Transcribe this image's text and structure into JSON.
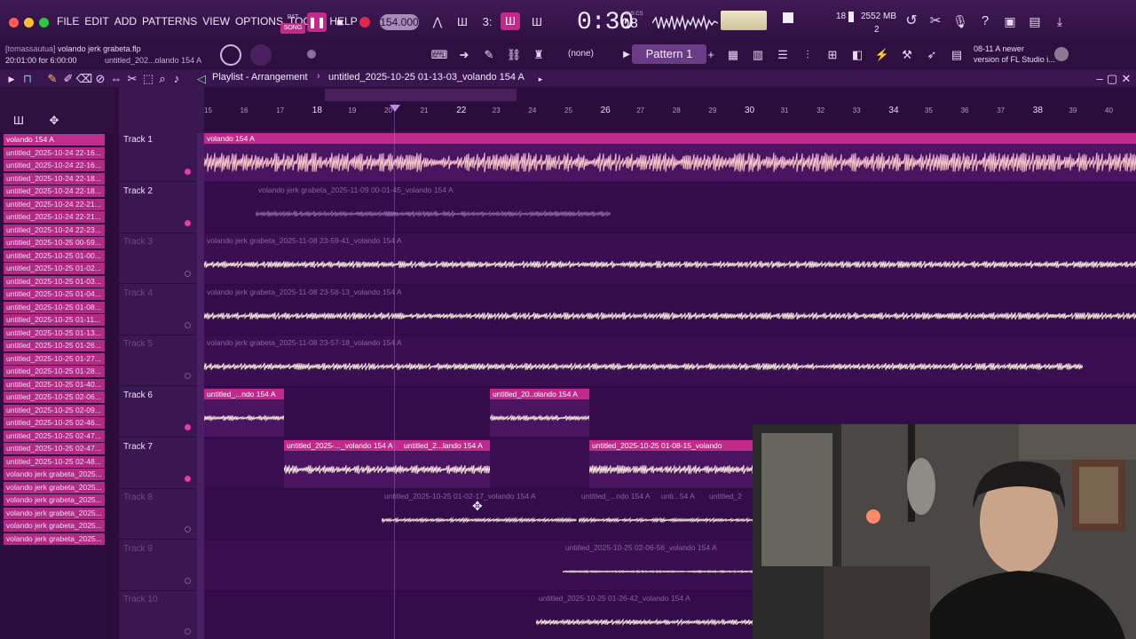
{
  "menu": [
    "FILE",
    "EDIT",
    "ADD",
    "PATTERNS",
    "VIEW",
    "OPTIONS",
    "TOOLS",
    "HELP"
  ],
  "transport": {
    "pat": "PAT",
    "song": "SONG",
    "tempo": "154.000",
    "time": "0:30",
    "time_sub": "08",
    "time_mode": "M:S:CS"
  },
  "monitor": {
    "cpu": "18",
    "memory": "2552 MB",
    "polyphony": "2"
  },
  "hints": {
    "user": "[tomassautua]",
    "file": "volando jerk grabeta.flp",
    "status": "20:01:00 for 6:00:00",
    "clip_hint": "untitled_202...olando 154 A"
  },
  "pattern_selector": {
    "none_label": "(none)",
    "pattern_label": "Pattern 1",
    "add": "+"
  },
  "news": {
    "line1": "08-11  A newer",
    "line2": "version of FL Studio i..."
  },
  "playlist": {
    "title": "Playlist - Arrangement",
    "separator": "›",
    "project": "untitled_2025-10-25 01-13-03_volando 154 A"
  },
  "browser_items": [
    "volando 154 A",
    "untitled_2025-10-24 22-16...",
    "untitled_2025-10-24 22-16...",
    "untitled_2025-10-24 22-18...",
    "untitled_2025-10-24 22-18...",
    "untitled_2025-10-24 22-21...",
    "untitled_2025-10-24 22-21...",
    "untitled_2025-10-24 22-23...",
    "untitled_2025-10-25 00-59...",
    "untitled_2025-10-25 01-00...",
    "untitled_2025-10-25 01-02...",
    "untitled_2025-10-25 01-03...",
    "untitled_2025-10-25 01-04...",
    "untitled_2025-10-25 01-08...",
    "untitled_2025-10-25 01-11...",
    "untitled_2025-10-25 01-13...",
    "untitled_2025-10-25 01-26...",
    "untitled_2025-10-25 01-27...",
    "untitled_2025-10-25 01-28...",
    "untitled_2025-10-25 01-40...",
    "untitled_2025-10-25 02-06...",
    "untitled_2025-10-25 02-09...",
    "untitled_2025-10-25 02-46...",
    "untitled_2025-10-25 02-47...",
    "untitled_2025-10-25 02-47...",
    "untitled_2025-10-25 02-48...",
    "volando jerk grabeta_2025...",
    "volando jerk grabeta_2025...",
    "volando jerk grabeta_2025...",
    "volando jerk grabeta_2025...",
    "volando jerk grabeta_2025...",
    "volando jerk grabeta_2025..."
  ],
  "tracks": [
    {
      "name": "Track 1",
      "active": true
    },
    {
      "name": "Track 2",
      "active": true
    },
    {
      "name": "Track 3",
      "active": false
    },
    {
      "name": "Track 4",
      "active": false
    },
    {
      "name": "Track 5",
      "active": false
    },
    {
      "name": "Track 6",
      "active": true
    },
    {
      "name": "Track 7",
      "active": true
    },
    {
      "name": "Track 8",
      "active": false
    },
    {
      "name": "Track 9",
      "active": false
    },
    {
      "name": "Track 10",
      "active": false
    }
  ],
  "ruler": [
    "15",
    "16",
    "17",
    "18",
    "19",
    "20",
    "21",
    "22",
    "23",
    "24",
    "25",
    "26",
    "27",
    "28",
    "29",
    "30",
    "31",
    "32",
    "33",
    "34",
    "35",
    "36",
    "37",
    "38",
    "39",
    "40"
  ],
  "clips": {
    "t1": "volando 154 A",
    "t2": "volando jerk grabeta_2025-11-09 00-01-45_volando 154 A",
    "t3": "volando jerk grabeta_2025-11-08 23-59-41_volando 154 A",
    "t4": "volando jerk grabeta_2025-11-08 23-58-13_volando 154 A",
    "t5": "volando jerk grabeta_2025-11-08 23-57-18_volando 154 A",
    "t6a": "untitled_...ndo 154 A",
    "t6b": "untitled_20..olando 154 A",
    "t7a": "untitled_2025-..._volando 154 A",
    "t7b": "untitled_2...lando 154 A",
    "t7c": "untitled_2025-10-25 01-08-15_volando",
    "t8a": "untitled_2025-10-25 01-02-17_volando 154 A",
    "t8b": "untitled_...ndo 154 A",
    "t8c": "unti...54 A",
    "t8d": "untitled_2",
    "t9": "untitled_2025-10-25 02-06-56_volando 154 A",
    "t10": "untitled_2025-10-25 01-26-42_volando 154 A"
  }
}
